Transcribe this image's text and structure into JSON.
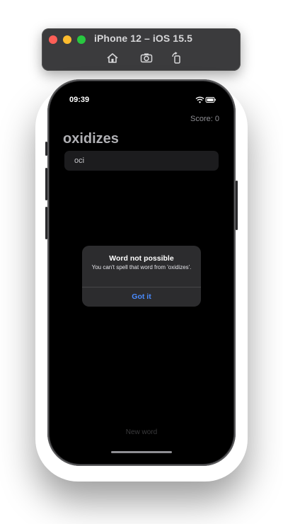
{
  "simulator": {
    "title": "iPhone 12 – iOS 15.5",
    "toolbar": [
      {
        "icon": "home-icon"
      },
      {
        "icon": "camera-icon"
      },
      {
        "icon": "rotate-icon"
      }
    ]
  },
  "status_bar": {
    "time": "09:39",
    "icons": [
      "wifi-icon",
      "battery-icon"
    ]
  },
  "app": {
    "score": "Score: 0",
    "root_word": "oxidizes",
    "input_value": "oci",
    "bottom_placeholder": "New word"
  },
  "alert": {
    "title": "Word not possible",
    "message": "You can't spell that word from 'oxidizes'.",
    "button": "Got it"
  },
  "colors": {
    "alert_button": "#4a8cff",
    "screen_background": "#000000"
  }
}
